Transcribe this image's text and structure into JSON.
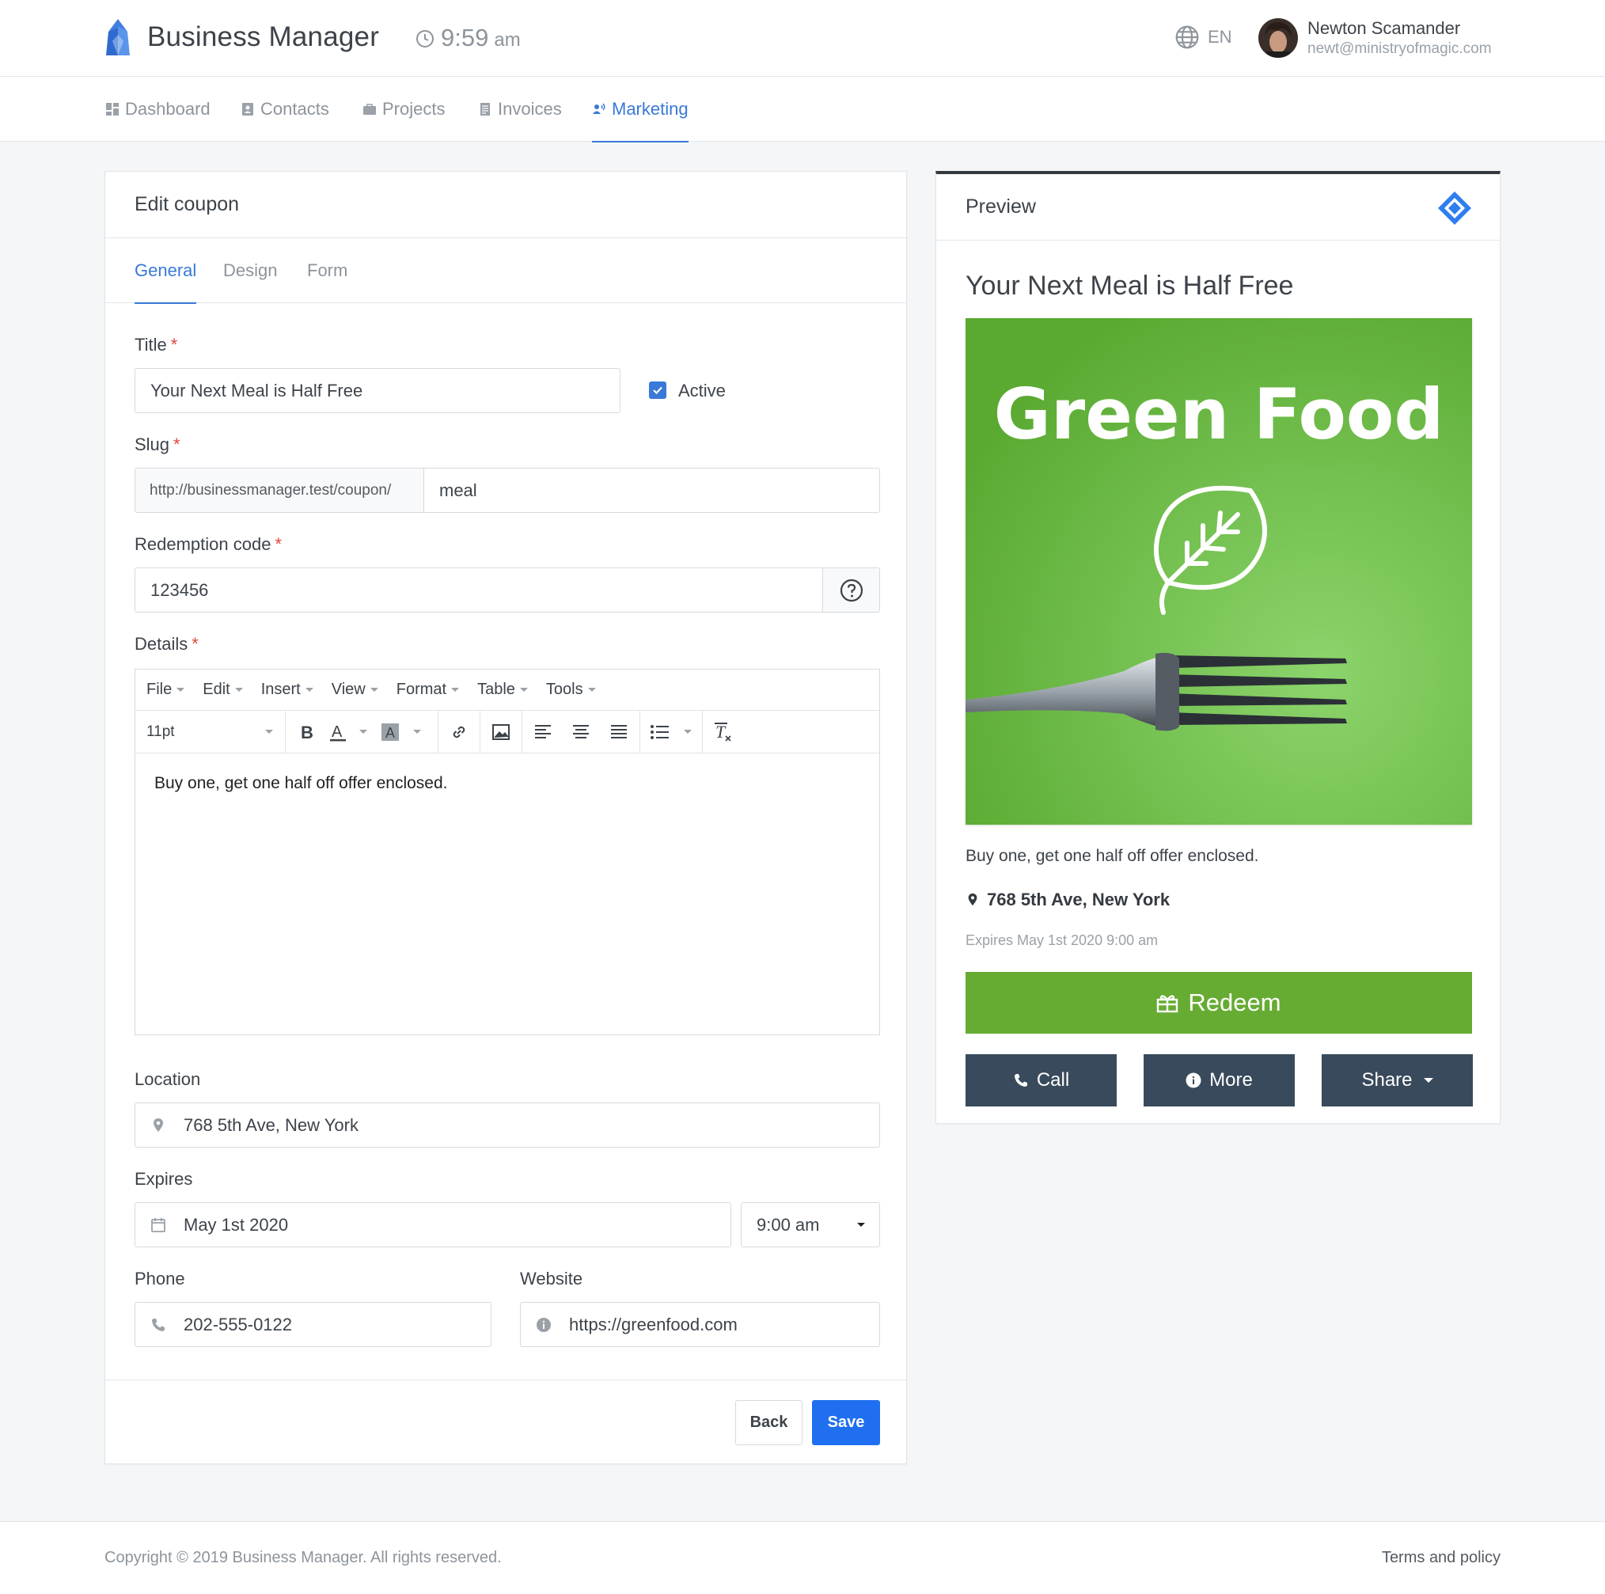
{
  "header": {
    "app_name": "Business Manager",
    "time": "9:59",
    "ampm": "am",
    "language": "EN",
    "user_name": "Newton Scamander",
    "user_email": "newt@ministryofmagic.com"
  },
  "nav": {
    "items": [
      {
        "label": "Dashboard",
        "icon": "dashboard-icon"
      },
      {
        "label": "Contacts",
        "icon": "contacts-icon"
      },
      {
        "label": "Projects",
        "icon": "briefcase-icon"
      },
      {
        "label": "Invoices",
        "icon": "invoice-icon"
      },
      {
        "label": "Marketing",
        "icon": "marketing-icon",
        "active": true
      }
    ]
  },
  "edit": {
    "heading": "Edit coupon",
    "tabs": [
      {
        "label": "General",
        "active": true
      },
      {
        "label": "Design"
      },
      {
        "label": "Form"
      }
    ],
    "title_label": "Title",
    "title_value": "Your Next Meal is Half Free",
    "active_label": "Active",
    "active_checked": true,
    "slug_label": "Slug",
    "slug_prefix": "http://businessmanager.test/coupon/",
    "slug_value": "meal",
    "code_label": "Redemption code",
    "code_value": "123456",
    "details_label": "Details",
    "editor_menus": [
      "File",
      "Edit",
      "Insert",
      "View",
      "Format",
      "Table",
      "Tools"
    ],
    "font_size": "11pt",
    "details_text": "Buy one, get one half off offer enclosed.",
    "location_label": "Location",
    "location_value": "768 5th Ave, New York",
    "expires_label": "Expires",
    "expires_date": "May 1st 2020",
    "expires_time": "9:00 am",
    "phone_label": "Phone",
    "phone_value": "202-555-0122",
    "website_label": "Website",
    "website_value": "https://greenfood.com",
    "back_label": "Back",
    "save_label": "Save"
  },
  "preview": {
    "heading": "Preview",
    "title": "Your Next Meal is Half Free",
    "image_text": "Green Food",
    "details": "Buy one, get one half off offer enclosed.",
    "location": "768 5th Ave, New York",
    "expires": "Expires May 1st 2020 9:00 am",
    "redeem_label": "Redeem",
    "call_label": "Call",
    "more_label": "More",
    "share_label": "Share"
  },
  "footer": {
    "copyright": "Copyright © 2019 Business Manager. All rights reserved.",
    "terms": "Terms and policy"
  },
  "colors": {
    "accent": "#3979d8",
    "save": "#1f6ff0",
    "redeem": "#66ac33",
    "preview_buttons": "#384a5b",
    "image_green": "#6bbb3e"
  }
}
